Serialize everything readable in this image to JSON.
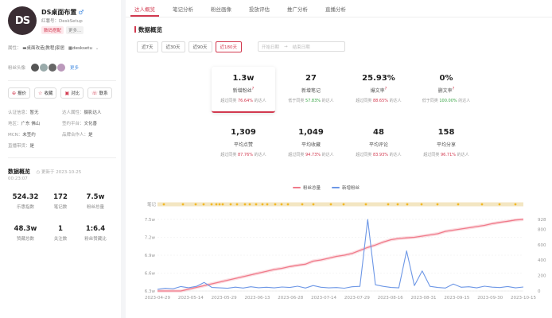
{
  "profile": {
    "avatar_text": "DS",
    "name": "DS桌面布置",
    "gender_icon": "♂",
    "redid_label": "红薯号：",
    "redid": "DeskSetup",
    "tags": [
      "数码搭配",
      "更多..."
    ],
    "location_label": "属性：",
    "location_items": [
      "▬桌面改造|教程|家居",
      "▦desksetu"
    ],
    "fans_label": "粉丝头像",
    "fans_more": "更多",
    "buttons": [
      "报价",
      "收藏",
      "对比",
      "联系"
    ],
    "info": [
      {
        "k": "认证信息：",
        "v": "暂无"
      },
      {
        "k": "达人属性：",
        "v": "摄影达人"
      },
      {
        "k": "地区：",
        "v": "广东 佛山"
      },
      {
        "k": "签约平台：",
        "v": "文化善"
      },
      {
        "k": "MCN：",
        "v": "未签约"
      },
      {
        "k": "品牌合作人：",
        "v": "是"
      },
      {
        "k": "直播带货：",
        "v": "是"
      }
    ]
  },
  "overview": {
    "title": "数据概览",
    "update_label": "更新于",
    "update_date": "2023-10-25",
    "update_time": "00:23:07",
    "stats": [
      {
        "value": "524.32",
        "label": "乐惠指数"
      },
      {
        "value": "172",
        "label": "笔记数"
      },
      {
        "value": "7.5w",
        "label": "粉丝总量"
      },
      {
        "value": "48.3w",
        "label": "赞藏总数"
      },
      {
        "value": "1",
        "label": "关注数"
      },
      {
        "value": "1:6.4",
        "label": "粉丝赞藏比"
      }
    ]
  },
  "tabs": [
    "达人概览",
    "笔记分析",
    "粉丝画像",
    "投放评估",
    "推广分析",
    "直播分析"
  ],
  "section_title": "数据概览",
  "ranges": [
    "近7天",
    "近30天",
    "近90天",
    "近180天"
  ],
  "date_start": "开始日期",
  "date_arrow": "→",
  "date_end": "结束日期",
  "cards": [
    {
      "value": "1.3w",
      "label": "新增粉丝",
      "cmp": "超过同类",
      "pct": "76.64%",
      "suffix": "的达人",
      "good": false,
      "q": "?"
    },
    {
      "value": "27",
      "label": "新增笔记",
      "cmp": "低于同类",
      "pct": "57.83%",
      "suffix": "的达人",
      "good": true,
      "q": ""
    },
    {
      "value": "25.93%",
      "label": "爆文率",
      "cmp": "超过同类",
      "pct": "88.65%",
      "suffix": "的达人",
      "good": false,
      "q": "?"
    },
    {
      "value": "0%",
      "label": "删文率",
      "cmp": "低于同类",
      "pct": "100.00%",
      "suffix": "的达人",
      "good": true,
      "q": "?"
    },
    {
      "value": "1,309",
      "label": "平均点赞",
      "cmp": "超过同类",
      "pct": "87.76%",
      "suffix": "的达人",
      "good": false,
      "q": ""
    },
    {
      "value": "1,049",
      "label": "平均收藏",
      "cmp": "超过同类",
      "pct": "94.73%",
      "suffix": "的达人",
      "good": false,
      "q": ""
    },
    {
      "value": "48",
      "label": "平均评论",
      "cmp": "超过同类",
      "pct": "83.93%",
      "suffix": "的达人",
      "good": false,
      "q": ""
    },
    {
      "value": "158",
      "label": "平均分享",
      "cmp": "超过同类",
      "pct": "96.71%",
      "suffix": "的达人",
      "good": false,
      "q": ""
    }
  ],
  "colors": {
    "accent": "#d2394f",
    "good": "#3aa547",
    "fans_line": "#f07a8a",
    "new_fans_line": "#6d97e6",
    "note_dot": "#f2b826"
  },
  "chart_data": {
    "type": "line",
    "legend": [
      "粉丝总量",
      "新增粉丝"
    ],
    "legend_placement": "top-center",
    "note_row_label": "笔记",
    "x_labels": [
      "2023-04-29",
      "2023-05-14",
      "2023-05-29",
      "2023-06-13",
      "2023-06-28",
      "2023-07-14",
      "2023-07-29",
      "2023-08-16",
      "2023-08-31",
      "2023-09-15",
      "2023-09-30",
      "2023-10-15"
    ],
    "y_left_ticks": [
      "6.3w",
      "6.6w",
      "6.9w",
      "7.2w",
      "7.5w"
    ],
    "y_left_range": [
      6.3,
      7.5
    ],
    "y_left_unit": "w",
    "y_right_ticks": [
      "0",
      "200",
      "400",
      "600",
      "800",
      "928"
    ],
    "y_right_range": [
      0,
      928
    ],
    "series": [
      {
        "name": "粉丝总量",
        "axis": "left",
        "values": [
          6.22,
          6.24,
          6.26,
          6.3,
          6.33,
          6.36,
          6.39,
          6.42,
          6.45,
          6.48,
          6.51,
          6.54,
          6.57,
          6.6,
          6.63,
          6.66,
          6.68,
          6.71,
          6.73,
          6.75,
          6.8,
          6.82,
          6.85,
          6.88,
          6.9,
          6.93,
          6.98,
          7.03,
          7.07,
          7.12,
          7.16,
          7.18,
          7.19,
          7.2,
          7.22,
          7.24,
          7.26,
          7.3,
          7.32,
          7.34,
          7.36,
          7.38,
          7.4,
          7.43,
          7.45,
          7.47,
          7.49,
          7.5
        ]
      },
      {
        "name": "新增粉丝",
        "axis": "right",
        "values": [
          22,
          35,
          28,
          58,
          42,
          60,
          110,
          45,
          40,
          35,
          50,
          38,
          55,
          42,
          48,
          40,
          52,
          45,
          62,
          38,
          70,
          48,
          40,
          44,
          36,
          55,
          60,
          928,
          80,
          60,
          45,
          40,
          520,
          70,
          260,
          60,
          45,
          38,
          90,
          48,
          55,
          40,
          62,
          50,
          44,
          58,
          40,
          52
        ]
      }
    ]
  }
}
